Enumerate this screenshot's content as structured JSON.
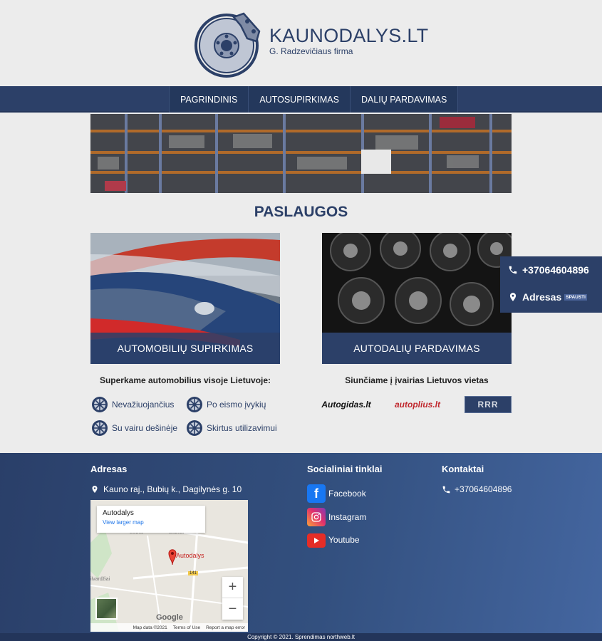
{
  "header": {
    "brand_title": "KAUNODALYS.LT",
    "brand_sub": "G. Radzevičiaus firma"
  },
  "nav": {
    "items": [
      {
        "label": "PAGRINDINIS"
      },
      {
        "label": "AUTOSUPIRKIMAS"
      },
      {
        "label": "DALIŲ PARDAVIMAS"
      }
    ]
  },
  "services": {
    "title": "PASLAUGOS",
    "cards": [
      {
        "label": "AUTOMOBILIŲ SUPIRKIMAS"
      },
      {
        "label": "AUTODALIŲ PARDAVIMAS"
      }
    ],
    "buy_heading": "Superkame automobilius visoje Lietuvoje:",
    "features": [
      "Nevažiuojančius",
      "Po eismo įvykių",
      "Su vairu dešinėje",
      "Skirtus utilizavimui"
    ],
    "ship_heading": "Siunčiame į įvairias Lietuvos vietas",
    "partners": [
      "Autogidas.lt",
      "autoplius.lt",
      "RRR"
    ]
  },
  "floating": {
    "phone": "+37064604896",
    "address_label": "Adresas",
    "address_badge": "SPAUSTI"
  },
  "footer": {
    "address_heading": "Adresas",
    "address_text": "Kauno raj., Bubių k., Dagilynės g. 10",
    "social_heading": "Socialiniai tinklai",
    "social": [
      {
        "label": "Facebook",
        "icon": "facebook-icon"
      },
      {
        "label": "Instagram",
        "icon": "instagram-icon"
      },
      {
        "label": "Youtube",
        "icon": "youtube-icon"
      }
    ],
    "contacts_heading": "Kontaktai",
    "phone": "+37064604896",
    "copyright": "Copyright © 2021. Sprendimas northweb.lt"
  },
  "map": {
    "place_title": "Autodalys",
    "larger_link": "View larger map",
    "marker_label": "Autodalys",
    "road": "141",
    "town1": "Bubiai",
    "town2": "Bubliai",
    "town3": "ilvardžiai",
    "google": "Google",
    "footer_items": [
      "Map data ©2021",
      "Terms of Use",
      "Report a map error"
    ]
  },
  "colors": {
    "brand": "#2c4068",
    "background": "#ececec",
    "accent_red": "#c0272d"
  }
}
